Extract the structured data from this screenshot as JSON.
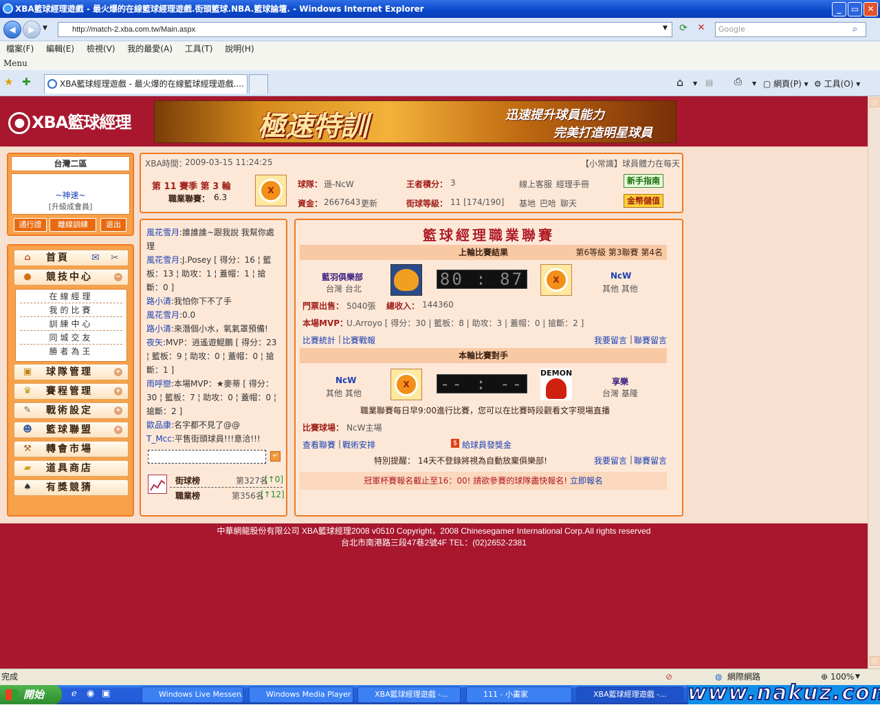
{
  "window": {
    "title": "XBA籃球經理遊戲 - 最火爆的在線籃球經理遊戲.街頭籃球.NBA.籃球論壇. - Windows Internet Explorer",
    "minimize": "_",
    "maximize": "▭",
    "close": "✕"
  },
  "address": {
    "url": "http://match-2.xba.com.tw/Main.aspx",
    "search_placeholder": "Google"
  },
  "menu": {
    "items": [
      "檔案(F)",
      "編輯(E)",
      "檢視(V)",
      "我的最愛(A)",
      "工具(T)",
      "說明(H)"
    ],
    "label": "Menu"
  },
  "tabs": {
    "active": "XBA籃球經理遊戲 - 最火爆的在線籃球經理遊戲....",
    "page_btn": "網頁(P)",
    "tools_btn": "工具(O)"
  },
  "header": {
    "logo_text": "XBA籃球經理",
    "banner_big": "極速特訓",
    "banner_line1": "迅速提升球員能力",
    "banner_line2": "完美打造明星球員"
  },
  "user": {
    "zone": "台灣二區",
    "name": "~神速~",
    "upgrade": "[升級成會員]",
    "btn_pass": "通行證",
    "btn_offline": "離線訓練",
    "btn_logout": "退出"
  },
  "nav": {
    "home": "首頁",
    "compete": "競技中心",
    "sub": [
      "在線經理",
      "我的比賽",
      "訓練中心",
      "同城交友",
      "勝者為王"
    ],
    "team": "球隊管理",
    "schedule": "賽程管理",
    "tactics": "戰術設定",
    "league": "籃球聯盟",
    "transfer": "轉會市場",
    "shop": "道具商店",
    "prize": "有獎競猜"
  },
  "info": {
    "time_label": "XBA時間：",
    "time": "2009-03-15 11:24:25",
    "tip": "【小常識】球員體力在每天",
    "season": "第 11 賽季 第 3 輪",
    "league_score_label": "職業聯賽：",
    "league_score": "6.3",
    "team_label": "球隊：",
    "team": "遜-NcW",
    "funds_label": "資金：",
    "funds": "2667643",
    "update": "更新",
    "king_label": "王者積分：",
    "king": "3",
    "street_label": "街球等級：",
    "street": "11 [174/190]",
    "links1": [
      "線上客服",
      "經理手冊"
    ],
    "links2": [
      "基地",
      "巴哈",
      "聊天"
    ],
    "newbie_btn": "新手指南",
    "coin_btn": "金幣儲值"
  },
  "chat": {
    "messages": [
      {
        "name": "風花雪月",
        "text": ":誰誰誰~跟我說 我幫你處理"
      },
      {
        "name": "風花雪月",
        "text": ":J.Posey [ 得分：16 ¦ 籃板：13 ¦ 助攻：1 ¦ 蓋帽：1 ¦ 搶斷：0 ]"
      },
      {
        "name": "路小清",
        "text": ":我怕你下不了手"
      },
      {
        "name": "風花雪月",
        "text": ":0.0"
      },
      {
        "name": "路小清",
        "text": ":來潛個小水，氧氣罩預備!"
      },
      {
        "name": "夜矢",
        "text": ":MVP：逍遙遊鯤鵬 [ 得分：23 ¦ 籃板：9 ¦ 助攻：0 ¦ 蓋帽：0 ¦ 搶斷：1 ]"
      },
      {
        "name": "雨呼戀",
        "text": ":本場MVP：★麥蒂 [ 得分：30 ¦ 籃板：7 ¦ 助攻：0 ¦ 蓋帽：0 ¦ 搶斷：2 ]"
      },
      {
        "name": "歐品康",
        "text": ":名字都不見了@@"
      },
      {
        "name": "T_Mcc",
        "text": ":平售街頭球員!!!意洽!!!"
      }
    ],
    "send": "↵"
  },
  "rank": {
    "street_label": "街球榜",
    "street_value": "第327名",
    "street_change": "[↑0]",
    "pro_label": "職業榜",
    "pro_value": "第356名",
    "pro_change": "[↑12]"
  },
  "league": {
    "title": "籃球經理職業聯賽",
    "last_header": "上輪比賽結果",
    "last_level": "第6等級 第3聯賽 第4名",
    "home_name": "藍羽俱樂部",
    "home_loc": "台灣 台北",
    "score": "80 : 87",
    "away_name": "NcW",
    "away_loc": "其他 其他",
    "tickets_label": "門票出售：",
    "tickets": "5040張",
    "income_label": "總收入：",
    "income": "144360",
    "mvp_label": "本場MVP：",
    "mvp": "U.Arroyo [ 得分：30 | 籃板：8 | 助攻：3 | 蓋帽：0 | 搶斷：2 ]",
    "stats_link": "比賽統計",
    "report_link": "比賽戰報",
    "msg_link": "我要留言",
    "league_msg_link": "聯賽留言",
    "next_header": "本輪比賽對手",
    "next_home": "NcW",
    "next_home_loc": "其他 其他",
    "next_score": "-- : --",
    "next_away": "享樂",
    "next_away_loc": "台灣 基隆",
    "demon_logo": "DEMON",
    "schedule_note": "職業聯賽每日早9:00進行比賽，您可以在比賽時段觀看文字現場直播",
    "venue_label": "比賽球場：",
    "venue": "NcW主場",
    "view_league": "查看聯賽",
    "tactic": "戰術安排",
    "bonus": "給球員發獎金",
    "warning": "特別提醒： 14天不登錄將視為自動放棄俱樂部!",
    "cup": "冠軍杯賽報名截止至16：00! 請欲參賽的球隊盡快報名!",
    "cup_link": "立即報名"
  },
  "footer": {
    "line1": "中華網龍股份有限公司 XBA籃球經理2008 v0510 Copyright，2008 Chinesegamer International Corp.All rights reserved",
    "line2": "台北市南港路三段47巷2號4F TEL：(02)2652-2381"
  },
  "status": {
    "text": "完成",
    "zone": "網際網路",
    "zoom": "100%"
  },
  "taskbar": {
    "start": "開始",
    "tasks": [
      "Windows Live Messen...",
      "Windows Media Player",
      "XBA籃球經理遊戲 -...",
      "111 - 小畫家",
      "XBA籃球經理遊戲 -..."
    ],
    "watermark": "www.nakuz.com"
  },
  "colors": {
    "page_bg": "#a8172e",
    "panel_border": "#f07a22",
    "link": "#1a3fb0"
  }
}
